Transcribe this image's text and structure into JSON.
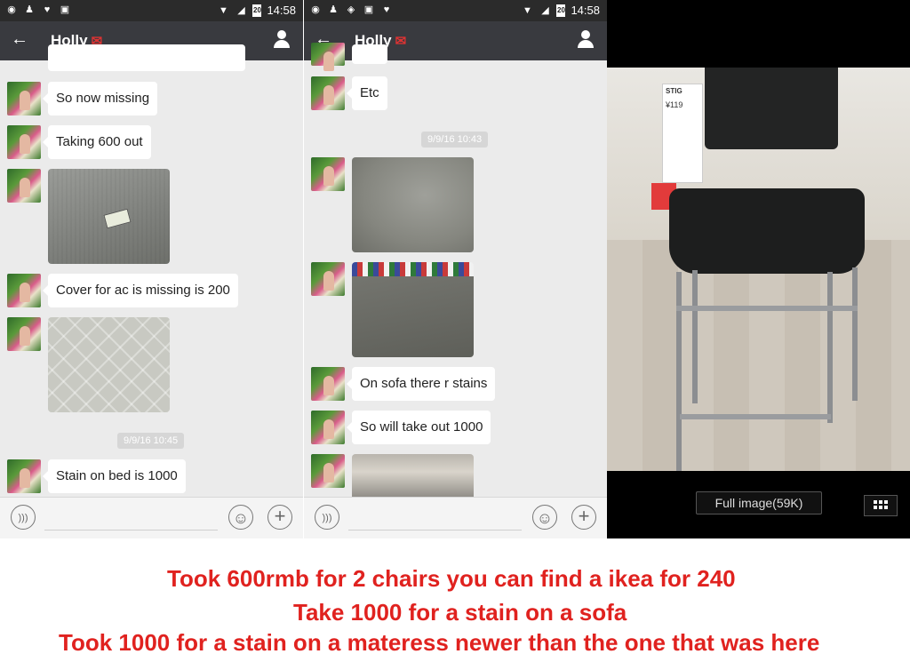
{
  "status_bar": {
    "time": "14:58",
    "battery": "20",
    "signal_label": "R"
  },
  "chat_left": {
    "contact_name": "Holly",
    "messages": [
      {
        "text": "So now missing"
      },
      {
        "text": "Taking 600 out"
      },
      {
        "text": "Cover for ac is missing is 200"
      },
      {
        "text": "Stain on bed is 1000"
      }
    ],
    "timestamp": "9/9/16 10:45"
  },
  "chat_right": {
    "contact_name": "Holly",
    "messages": [
      {
        "text": "Etc"
      },
      {
        "text": "On sofa there r stains"
      },
      {
        "text": "So will take out 1000"
      }
    ],
    "timestamp": "9/9/16 10:43"
  },
  "image_viewer": {
    "full_image_label": "Full image(59K)",
    "price_tag": "¥119",
    "product_tag": "STIG"
  },
  "captions": [
    "Took 600rmb for 2 chairs you can find a ikea for 240",
    "Take 1000 for a stain on a sofa",
    "Took 1000 for a stain on a materess newer than the one that was here"
  ],
  "colors": {
    "caption": "#e0221f",
    "titlebar": "#393a3f",
    "statusbar": "#2b2b2b"
  }
}
